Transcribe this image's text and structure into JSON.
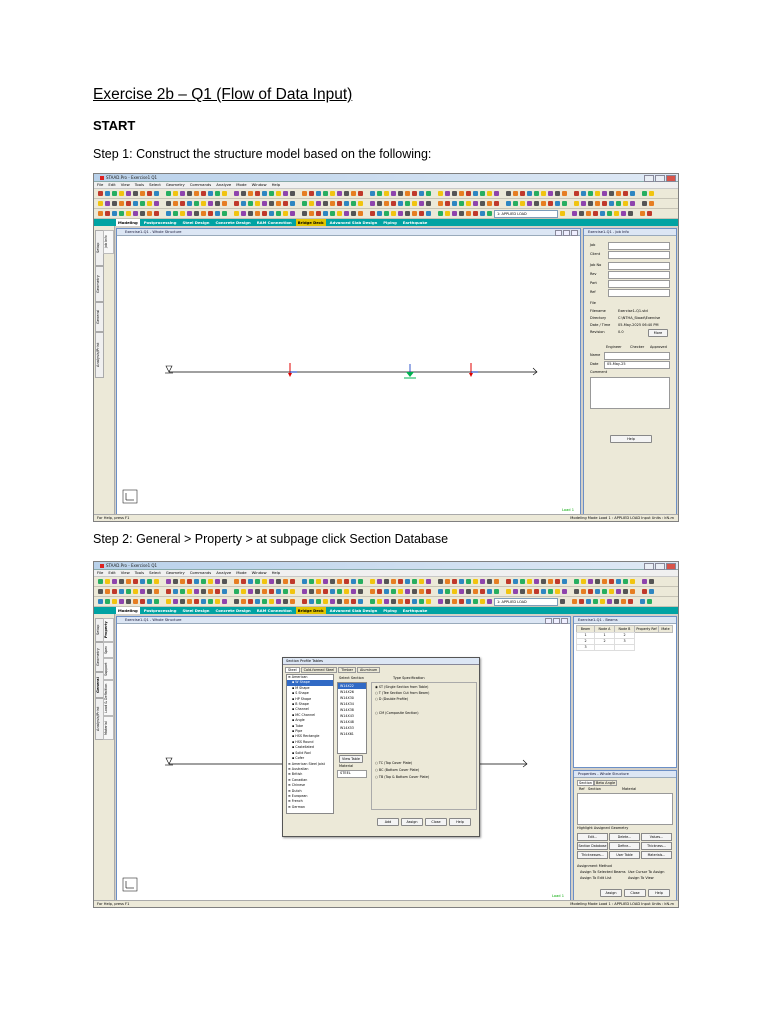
{
  "document": {
    "title": "Exercise 2b – Q1 (Flow of Data Input)",
    "start": "START",
    "step1": "Step 1: Construct the structure model based on the following:",
    "step2": "Step 2: General > Property > at subpage click Section Database"
  },
  "app": {
    "window_title": "STAAD.Pro - Exercise1 Q1",
    "menus": [
      "File",
      "Edit",
      "View",
      "Tools",
      "Select",
      "Geometry",
      "Commands",
      "Analyze",
      "Mode",
      "Window",
      "Help"
    ],
    "mode_tabs": [
      "Modeling",
      "Postprocessing",
      "Steel Design",
      "Concrete Design",
      "RAM Connection",
      "Bridge Deck",
      "Advanced Slab Design",
      "Piping",
      "Earthquake"
    ],
    "combo_value": "1: APPLIED LOAD",
    "status_left": "For Help, press F1",
    "status_right": "Modeling Mode  Load 1 : APPLIED LOAD     Input Units : kN-m",
    "load_label": "Load 1"
  },
  "shot1": {
    "view_title": "Exercise1-Q1 - Whole Structure",
    "info_title": "Exercise1-Q1 - Job Info",
    "side_tabs": [
      "Setup",
      "Geometry",
      "General",
      "Analysis/Print"
    ],
    "sub_tabs": [
      "Job Info"
    ],
    "info_labels": [
      "Job",
      "Client",
      "Job No",
      "Rev",
      "Part",
      "Ref",
      "File"
    ],
    "filename_label": "Filename",
    "filename": "Exercise1-Q1.std",
    "directory_label": "Directory",
    "directory": "C:\\NTHA_Staad\\Exercise",
    "datetime_label": "Date / Time",
    "datetime": "05-May-2025  06:40 PM",
    "revision_label": "Revision",
    "revision": "0.0",
    "more_button": "More",
    "col_engineer": "Engineer",
    "col_checker": "Checker",
    "col_approved": "Approved",
    "name_label": "Name",
    "date_label": "Date",
    "date_value": "05-May-25",
    "comment_label": "Comment",
    "help_button": "Help"
  },
  "shot2": {
    "view_title": "Exercise1-Q1 - Whole Structure",
    "nodes_title": "Exercise1-Q1 - Beams",
    "side_tabs": [
      "Setup",
      "Geometry",
      "General",
      "Analysis/Print"
    ],
    "sub_tabs": [
      "Property",
      "Spec",
      "Support",
      "Load & Definition",
      "Material"
    ],
    "grid_headers": [
      "Beam",
      "Node A",
      "Node B",
      "Property Ref",
      "Mate"
    ],
    "grid_rows": [
      [
        "1",
        "1",
        "2"
      ],
      [
        "2",
        "2",
        "3"
      ],
      [
        "3",
        "",
        ""
      ]
    ],
    "dialog_title": "Section Profile Tables",
    "dialog_tabs": [
      "Steel",
      "Cold-formed Steel",
      "Timber",
      "Aluminum"
    ],
    "tree_items": [
      "American",
      "W Shape",
      "M Shape",
      "S Shape",
      "HP Shape",
      "B Shape",
      "Channel",
      "MC Channel",
      "Angle",
      "Tube",
      "Pipe",
      "HSS Rectangle",
      "HSS Round",
      "Castellated",
      "Solid Rod",
      "Cofer",
      "American Steel Joist",
      "Australian",
      "British",
      "Canadian",
      "Chinese",
      "Dutch",
      "European",
      "French",
      "German"
    ],
    "select_section_label": "Select Section",
    "sections": [
      "W14X22",
      "W14X26",
      "W14X30",
      "W14X34",
      "W14X38",
      "W14X43",
      "W14X48",
      "W14X53",
      "W14X61"
    ],
    "type_spec_label": "Type Specification",
    "type_options": [
      "ST (Single Section from Table)",
      "T (Tee Section Cut from Beam)",
      "D (Double Profile)",
      "CM (Composite Section)",
      "TC (Top Cover Plate)",
      "BC (Bottom Cover Plate)",
      "TB (Top & Bottom Cover Plate)"
    ],
    "view_table_button": "View Table",
    "material_checkbox": "Material",
    "material_value": "STEEL",
    "dialog_buttons": [
      "Add",
      "Assign",
      "Close",
      "Help"
    ],
    "props_title": "Properties - Whole Structure",
    "props_tabs": [
      "Section",
      "Beta Angle"
    ],
    "props_cols": [
      "Ref",
      "Section",
      "Material"
    ],
    "highlight_label": "Highlight Assigned Geometry",
    "props_buttons": [
      "Edit...",
      "Delete...",
      "Values...",
      "Section Database",
      "Define...",
      "Thickness...",
      "Thicknesses...",
      "User Table",
      "Materials..."
    ],
    "assign_method_label": "Assignment Method",
    "assign_options": [
      "Assign To Selected Beams",
      "Assign To Edit List",
      "Use Cursor To Assign",
      "Assign To View"
    ],
    "props_bottom": [
      "Assign",
      "Close",
      "Help"
    ]
  },
  "colors": {
    "teal": "#00a3a3",
    "support": "#00b050",
    "load_red": "#e00000",
    "load_blue": "#0030c0"
  },
  "icons": [
    "node-support-icon",
    "member-load-icon",
    "fixed-support-icon",
    "axis-triad-icon"
  ]
}
